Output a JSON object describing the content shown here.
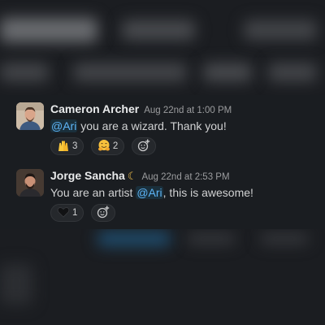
{
  "messages": [
    {
      "author": "Cameron Archer",
      "timestamp": "Aug 22nd at 1:00 PM",
      "mention": "@Ari",
      "text_after": " you are a wizard. Thank you!",
      "reactions": [
        {
          "emoji": "raised-hands-icon",
          "count": "3"
        },
        {
          "emoji": "hugging-face-icon",
          "count": "2"
        }
      ]
    },
    {
      "author": "Jorge Sancha",
      "status_emoji": "crescent-moon-icon",
      "timestamp": "Aug 22nd at 2:53 PM",
      "text_before": "You are an artist ",
      "mention": "@Ari",
      "text_after": ", this is awesome!",
      "reactions": [
        {
          "emoji": "black-heart-icon",
          "count": "1"
        }
      ]
    }
  ],
  "colors": {
    "background": "#1a1d21",
    "mention": "#5eb5f7",
    "author": "#e9eaeb",
    "timestamp": "#9b9c9e"
  }
}
